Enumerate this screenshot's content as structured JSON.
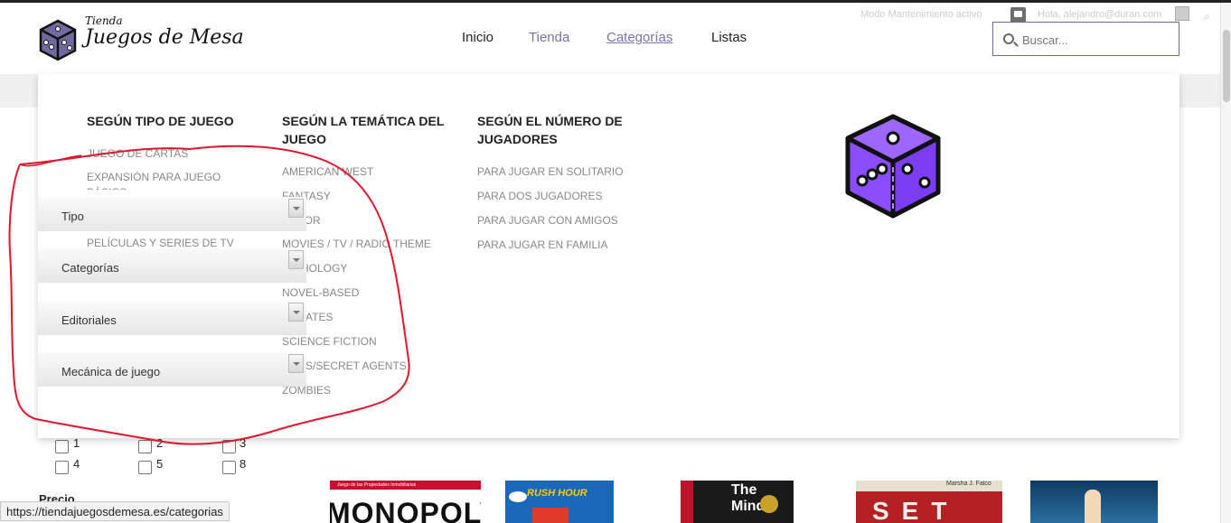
{
  "header": {
    "logo_small": "Tienda",
    "logo_main": "Juegos de Mesa",
    "nav": [
      "Inicio",
      "Tienda",
      "Categorías",
      "Listas"
    ],
    "maintenance": "Modo Mantenimiento activo",
    "greeting": "Hola, alejandro@duran.com",
    "search_placeholder": "Buscar..."
  },
  "mega_menu": {
    "col1": {
      "title": "SEGÚN TIPO DE JUEGO",
      "items": [
        "JUEGO DE CARTAS",
        "EXPANSIÓN PARA JUEGO BÁSICO",
        "PELÍCULAS Y SERIES DE TV"
      ]
    },
    "col2": {
      "title": "SEGÚN LA TEMÁTICA DEL JUEGO",
      "items": [
        "AMERICAN WEST",
        "FANTASY",
        "ROR",
        "MOVIES / TV / RADIO THEME",
        "HOLOGY",
        "NOVEL-BASED",
        "ATES",
        "SCIENCE FICTION",
        "S/SECRET AGENTS",
        "ZOMBIES"
      ]
    },
    "col3": {
      "title": "SEGÚN EL NÚMERO DE JUGADORES",
      "items": [
        "PARA JUGAR EN SOLITARIO",
        "PARA DOS JUGADORES",
        "PARA JUGAR CON AMIGOS",
        "PARA JUGAR EN FAMILIA"
      ]
    },
    "dice_color": "#8a4dff"
  },
  "filters": [
    "Tipo",
    "Categorías",
    "Editoriales",
    "Mecánica de juego"
  ],
  "players": [
    "1",
    "2",
    "3",
    "4",
    "5",
    "8"
  ],
  "price_label": "Precio",
  "products": {
    "p1_name": "MONOPOLY",
    "p1_tiny": "Juego de las Propiedades Inmobiliarias",
    "p2_name": "RUSH HOUR",
    "p3_name": "The Mind",
    "p4_tiny": "Marsha J. Falco",
    "p4_name": "SET"
  },
  "status_url": "https://tiendajuegosdemesa.es/categorias",
  "colors": {
    "accent": "#7b73a7",
    "annotation": "#e0162b"
  }
}
